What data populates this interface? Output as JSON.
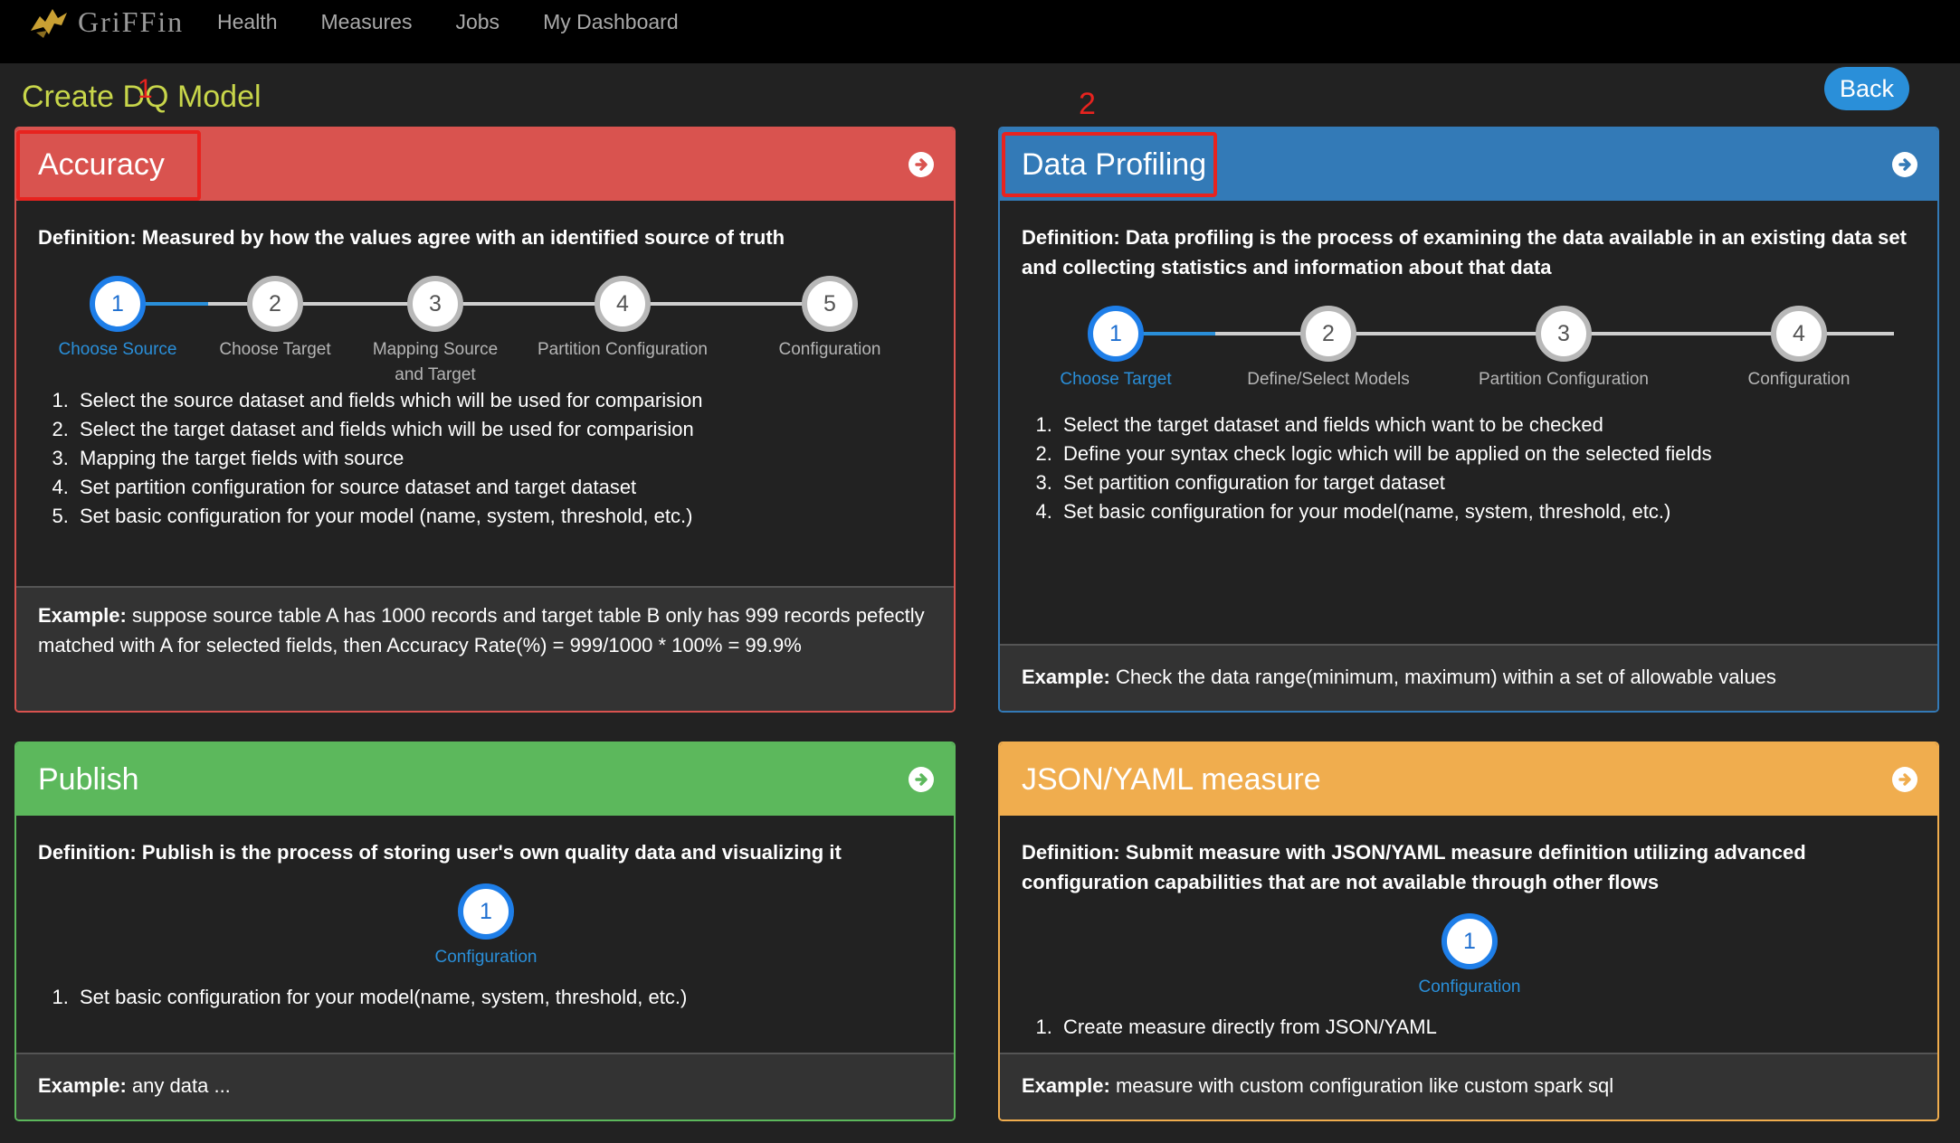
{
  "nav": {
    "brand": "GriFFin",
    "items": [
      "Health",
      "Measures",
      "Jobs",
      "My Dashboard"
    ]
  },
  "page": {
    "title": "Create DQ Model",
    "back_label": "Back"
  },
  "annotations": [
    "1",
    "2"
  ],
  "colors": {
    "accuracy": "#d9534f",
    "profiling": "#337ab7",
    "publish": "#5cb85c",
    "json": "#f0ad4e",
    "active_step": "#1e7ee8",
    "title": "#c8d64a"
  },
  "cards": {
    "accuracy": {
      "title": "Accuracy",
      "definition": "Definition: Measured by how the values agree with an identified source of truth",
      "steps": [
        {
          "num": "1",
          "label": "Choose Source"
        },
        {
          "num": "2",
          "label": "Choose Target"
        },
        {
          "num": "3",
          "label": "Mapping Source and Target"
        },
        {
          "num": "4",
          "label": "Partition Configuration"
        },
        {
          "num": "5",
          "label": "Configuration"
        }
      ],
      "list": [
        "Select the source dataset and fields which will be used for comparision",
        "Select the target dataset and fields which will be used for comparision",
        "Mapping the target fields with source",
        "Set partition configuration for source dataset and target dataset",
        "Set basic configuration for your model (name, system, threshold, etc.)"
      ],
      "example_label": "Example:",
      "example_text": " suppose source table A has 1000 records and target table B only has 999 records pefectly matched with A for selected fields, then Accuracy Rate(%) = 999/1000 * 100% = 99.9%"
    },
    "profiling": {
      "title": "Data Profiling",
      "definition": "Definition: Data profiling is the process of examining the data available in an existing data set and collecting statistics and information about that data",
      "steps": [
        {
          "num": "1",
          "label": "Choose Target"
        },
        {
          "num": "2",
          "label": "Define/Select Models"
        },
        {
          "num": "3",
          "label": "Partition Configuration"
        },
        {
          "num": "4",
          "label": "Configuration"
        }
      ],
      "list": [
        "Select the target dataset and fields which want to be checked",
        "Define your syntax check logic which will be applied on the selected fields",
        "Set partition configuration for target dataset",
        "Set basic configuration for your model(name, system, threshold, etc.)"
      ],
      "example_label": "Example:",
      "example_text": " Check the data range(minimum, maximum) within a set of allowable values"
    },
    "publish": {
      "title": "Publish",
      "definition": "Definition: Publish is the process of storing user's own quality data and visualizing it",
      "steps": [
        {
          "num": "1",
          "label": "Configuration"
        }
      ],
      "list": [
        "Set basic configuration for your model(name, system, threshold, etc.)"
      ],
      "example_label": "Example:",
      "example_text": " any data ..."
    },
    "json": {
      "title": "JSON/YAML measure",
      "definition": "Definition: Submit measure with JSON/YAML measure definition utilizing advanced configuration capabilities that are not available through other flows",
      "steps": [
        {
          "num": "1",
          "label": "Configuration"
        }
      ],
      "list": [
        "Create measure directly from JSON/YAML"
      ],
      "example_label": "Example:",
      "example_text": " measure with custom configuration like custom spark sql"
    }
  }
}
